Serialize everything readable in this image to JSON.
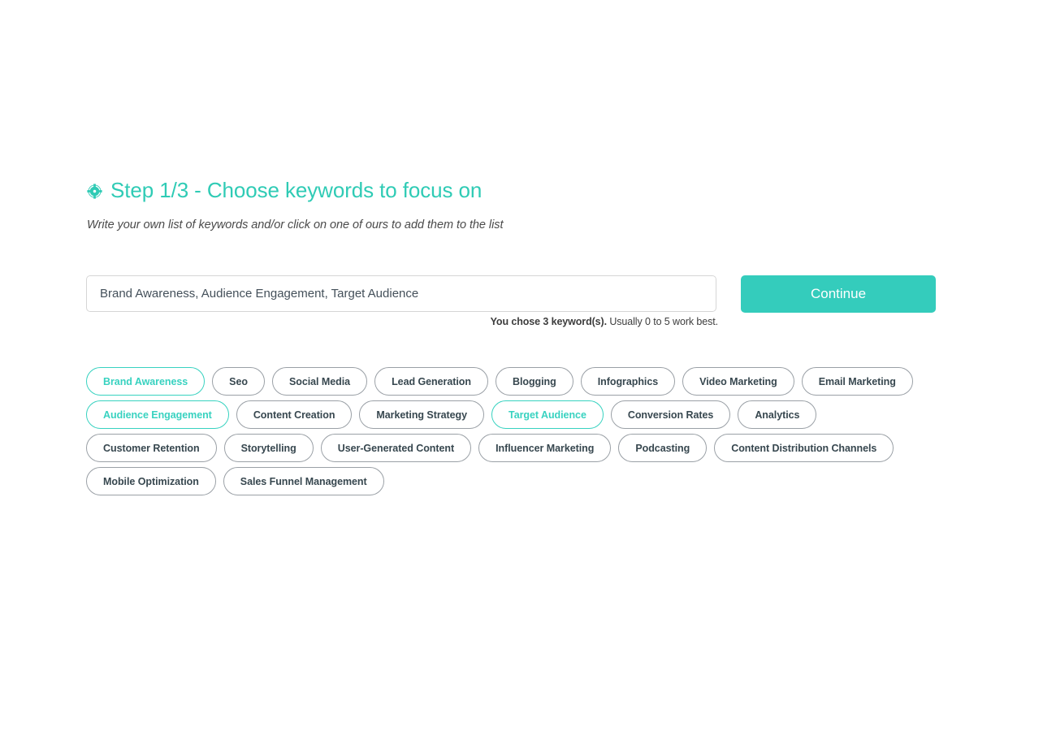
{
  "wizard": {
    "heading_icon": "target-crosshair-icon",
    "heading": "Step 1/3 - Choose keywords to focus on",
    "subtitle": "Write your own list of keywords and/or click on one of ours to add them to the list"
  },
  "form": {
    "keyword_input_value": "Brand Awareness, Audience Engagement, Target Audience",
    "keyword_input_placeholder": "",
    "continue_label": "Continue",
    "helper_strong": "You chose 3 keyword(s).",
    "helper_normal": "Usually 0 to 5 work best.",
    "chosen_count": 3
  },
  "keywords": [
    {
      "label": "Brand Awareness",
      "selected": true
    },
    {
      "label": "Seo",
      "selected": false
    },
    {
      "label": "Social Media",
      "selected": false
    },
    {
      "label": "Lead Generation",
      "selected": false
    },
    {
      "label": "Blogging",
      "selected": false
    },
    {
      "label": "Infographics",
      "selected": false
    },
    {
      "label": "Video Marketing",
      "selected": false
    },
    {
      "label": "Email Marketing",
      "selected": false
    },
    {
      "label": "Audience Engagement",
      "selected": true
    },
    {
      "label": "Content Creation",
      "selected": false
    },
    {
      "label": "Marketing Strategy",
      "selected": false
    },
    {
      "label": "Target Audience",
      "selected": true
    },
    {
      "label": "Conversion Rates",
      "selected": false
    },
    {
      "label": "Analytics",
      "selected": false
    },
    {
      "label": "Customer Retention",
      "selected": false
    },
    {
      "label": "Storytelling",
      "selected": false
    },
    {
      "label": "User-Generated Content",
      "selected": false
    },
    {
      "label": "Influencer Marketing",
      "selected": false
    },
    {
      "label": "Podcasting",
      "selected": false
    },
    {
      "label": "Content Distribution Channels",
      "selected": false
    },
    {
      "label": "Mobile Optimization",
      "selected": false
    },
    {
      "label": "Sales Funnel Management",
      "selected": false
    }
  ],
  "colors": {
    "accent": "#34CCBC",
    "heading": "#2FCBB5",
    "chip_border": "#9aa0a6",
    "chip_text": "#37474f",
    "chip_selected": "#38D2C0",
    "background": "#ffffff"
  }
}
